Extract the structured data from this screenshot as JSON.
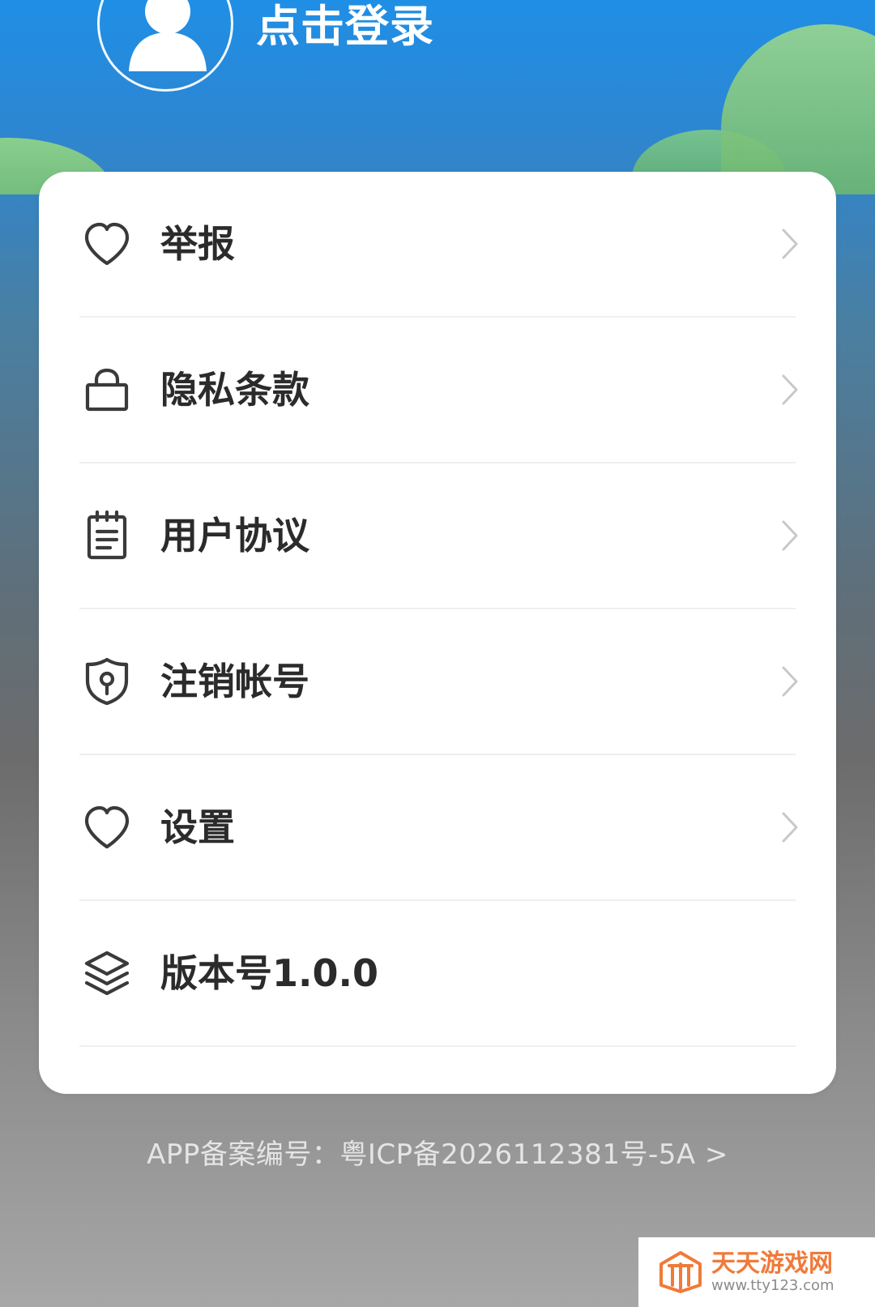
{
  "header": {
    "login_text": "点击登录"
  },
  "menu": {
    "items": [
      {
        "label": "举报",
        "icon": "heart-icon"
      },
      {
        "label": "隐私条款",
        "icon": "lock-icon"
      },
      {
        "label": "用户协议",
        "icon": "notepad-icon"
      },
      {
        "label": "注销帐号",
        "icon": "shield-key-icon"
      },
      {
        "label": "设置",
        "icon": "heart-icon"
      },
      {
        "label": "版本号1.0.0",
        "icon": "layers-icon"
      }
    ]
  },
  "footer": {
    "icp_text": "APP备案编号：粤ICP备2026112381号-5A >"
  },
  "watermark": {
    "cn": "天天游戏网",
    "url": "www.tty123.com"
  },
  "colors": {
    "card_bg": "#ffffff",
    "text_primary": "#2b2b2b",
    "accent_orange": "#f07a3a"
  }
}
